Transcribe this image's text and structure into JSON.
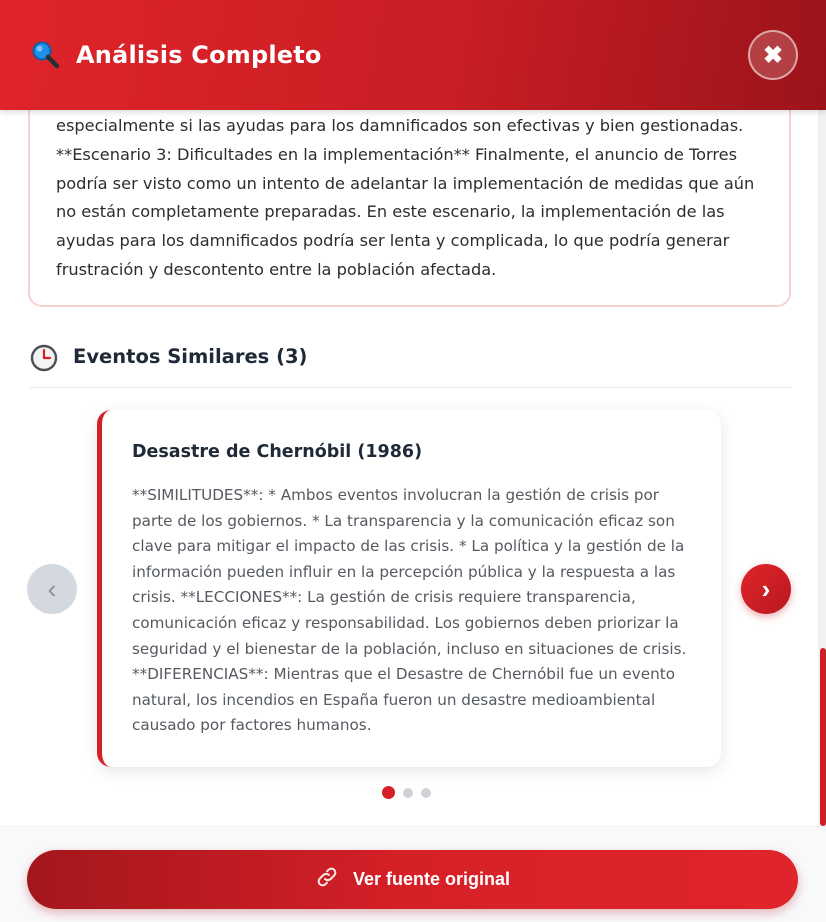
{
  "header": {
    "title": "Análisis Completo",
    "icon": "magnifier-icon",
    "close_label": "✖"
  },
  "analysis": {
    "text": "especialmente si las ayudas para los damnificados son efectivas y bien gestionadas. **Escenario 3: Dificultades en la implementación** Finalmente, el anuncio de Torres podría ser visto como un intento de adelantar la implementación de medidas que aún no están completamente preparadas. En este escenario, la implementación de las ayudas para los damnificados podría ser lenta y complicada, lo que podría generar frustración y descontento entre la población afectada."
  },
  "similar_events": {
    "title": "Eventos Similares (3)",
    "icon": "clock-icon",
    "prev_label": "‹",
    "next_label": "›",
    "active_index": 0,
    "count": 3,
    "current": {
      "title": "Desastre de Chernóbil (1986)",
      "text": "**SIMILITUDES**: * Ambos eventos involucran la gestión de crisis por parte de los gobiernos. * La transparencia y la comunicación eficaz son clave para mitigar el impacto de las crisis. * La política y la gestión de la información pueden influir en la percepción pública y la respuesta a las crisis. **LECCIONES**: La gestión de crisis requiere transparencia, comunicación eficaz y responsabilidad. Los gobiernos deben priorizar la seguridad y el bienestar de la población, incluso en situaciones de crisis. **DIFERENCIAS**: Mientras que el Desastre de Chernóbil fue un evento natural, los incendios en España fueron un desastre medioambiental causado por factores humanos."
    }
  },
  "footer": {
    "source_label": "Ver fuente original",
    "source_icon": "link-icon"
  },
  "colors": {
    "accent": "#d62027",
    "accent_dark": "#9b141a",
    "muted": "#cfd3d9"
  }
}
